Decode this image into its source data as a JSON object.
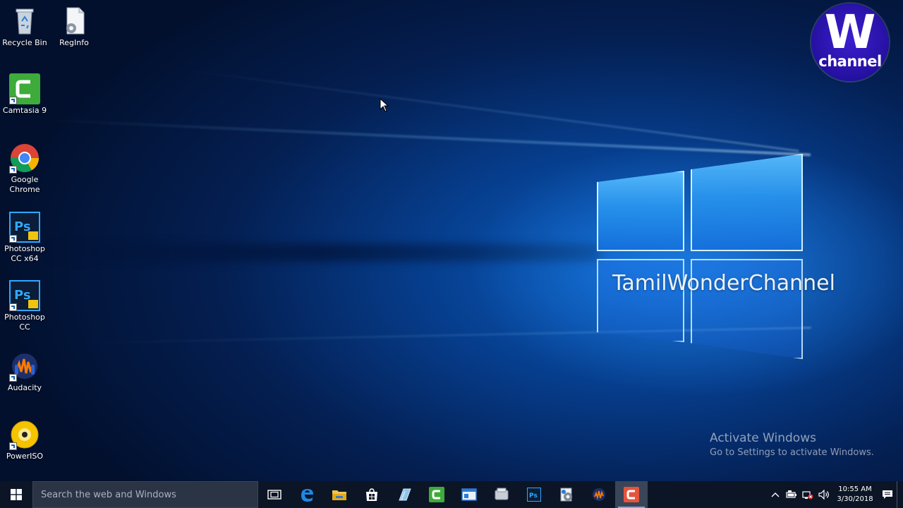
{
  "desktop": {
    "icons": [
      {
        "id": "recycle-bin",
        "label": "Recycle Bin",
        "icon": "recycle-bin-icon"
      },
      {
        "id": "reginfo",
        "label": "RegInfo",
        "icon": "settings-file-icon"
      },
      {
        "id": "camtasia",
        "label": "Camtasia 9",
        "icon": "camtasia-icon"
      },
      {
        "id": "chrome",
        "label": "Google Chrome",
        "icon": "chrome-icon"
      },
      {
        "id": "photoshop-cc-x64",
        "label": "Photoshop CC x64",
        "icon": "photoshop-icon"
      },
      {
        "id": "photoshop-cc",
        "label": "Photoshop CC",
        "icon": "photoshop-icon"
      },
      {
        "id": "audacity",
        "label": "Audacity",
        "icon": "audacity-icon"
      },
      {
        "id": "poweriso",
        "label": "PowerISO",
        "icon": "disc-icon"
      }
    ],
    "channel_logo": {
      "letter": "W",
      "word": "channel"
    },
    "watermark": "TamilWonderChannel",
    "activation": {
      "title": "Activate Windows",
      "subtitle": "Go to Settings to activate Windows."
    }
  },
  "taskbar": {
    "search_placeholder": "Search the web and Windows",
    "pinned": [
      {
        "name": "task-view",
        "icon": "task-view-icon"
      },
      {
        "name": "edge",
        "icon": "edge-icon"
      },
      {
        "name": "file-explorer",
        "icon": "folder-icon"
      },
      {
        "name": "store",
        "icon": "store-icon"
      },
      {
        "name": "app-blue",
        "icon": "glass-app-icon"
      },
      {
        "name": "camtasia",
        "icon": "camtasia-icon"
      },
      {
        "name": "app-window",
        "icon": "window-app-icon"
      },
      {
        "name": "app-gray",
        "icon": "gray-app-icon"
      },
      {
        "name": "photoshop",
        "icon": "photoshop-icon"
      },
      {
        "name": "app-settings",
        "icon": "gear-app-icon"
      },
      {
        "name": "audacity",
        "icon": "audacity-icon"
      },
      {
        "name": "camtasia-recorder",
        "icon": "recorder-icon"
      }
    ],
    "tray": {
      "time": "10:55 AM",
      "date": "3/30/2018"
    }
  },
  "colors": {
    "taskbar": "#0b1526",
    "search_bg": "#2b3445",
    "accent": "#1e88e5"
  }
}
